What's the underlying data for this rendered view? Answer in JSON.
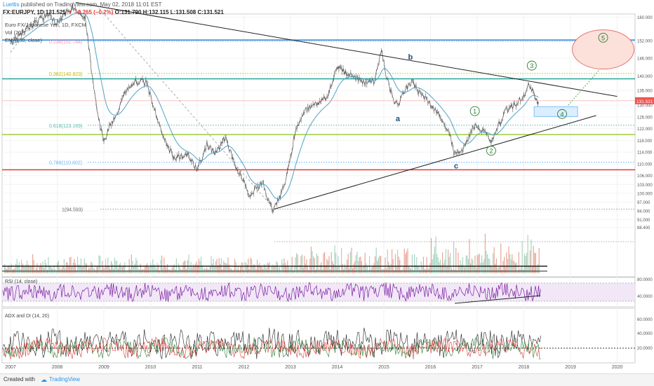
{
  "header": {
    "author": "Luettis",
    "published": " published on TradingView.com, May 02, 2018 11:01 EST",
    "symbol": "FX:EURJPY, 1D",
    "last": "131.525",
    "change": "▼ −0.265 (−0.2%)",
    "ohlc": "O:131.790 H:132.115 L:131.508 C:131.521"
  },
  "legend": {
    "series": "Euro FX/Japanese Yen, 1D, FXCM",
    "volume": "Vol (20)",
    "ema": "EMA (50, close)"
  },
  "footer": {
    "created": "Created with",
    "brand": "TradingView"
  },
  "colors": {
    "price": "#5a5a5a",
    "ema": "#4fa3c7",
    "rsi": "#7b1fa2",
    "adx": "#222222",
    "di_plus": "#2e7d32",
    "di_minus": "#e53935",
    "volume_up": "#e8a79a",
    "volume_down": "#a8d5c2",
    "trendline": "#222222",
    "wave_label": "#2e7d32",
    "letter_label": "#1f4e79"
  },
  "chart_data": [
    {
      "type": "line",
      "title": "",
      "x_axis": [
        "2007",
        "2008",
        "2009",
        "2010",
        "2011",
        "2012",
        "2013",
        "2014",
        "2015",
        "2016",
        "2017",
        "2018",
        "2019",
        "2020"
      ],
      "y_axis_ticks": [
        "160.000",
        "152.000",
        "146.000",
        "140.000",
        "135.000",
        "130.000",
        "126.000",
        "122.000",
        "118.000",
        "114.000",
        "110.000",
        "106.000",
        "103.000",
        "100.000",
        "97.000",
        "94.000",
        "91.000",
        "88.400"
      ],
      "last_price_label": "131.521",
      "price_path": [
        [
          "2007.0",
          151
        ],
        [
          "2007.2",
          154
        ],
        [
          "2007.5",
          158
        ],
        [
          "2007.8",
          161
        ],
        [
          "2008.0",
          158
        ],
        [
          "2008.3",
          163
        ],
        [
          "2008.6",
          160
        ],
        [
          "2008.75",
          140
        ],
        [
          "2008.85",
          128
        ],
        [
          "2009.0",
          117
        ],
        [
          "2009.1",
          122
        ],
        [
          "2009.3",
          128
        ],
        [
          "2009.5",
          136
        ],
        [
          "2009.7",
          138
        ],
        [
          "2009.9",
          138
        ],
        [
          "2010.1",
          128
        ],
        [
          "2010.3",
          118
        ],
        [
          "2010.5",
          112
        ],
        [
          "2010.8",
          113
        ],
        [
          "2011.0",
          108
        ],
        [
          "2011.2",
          116
        ],
        [
          "2011.4",
          114
        ],
        [
          "2011.6",
          119
        ],
        [
          "2011.8",
          110
        ],
        [
          "2012.0",
          104
        ],
        [
          "2012.1",
          99
        ],
        [
          "2012.3",
          102
        ],
        [
          "2012.4",
          104
        ],
        [
          "2012.55",
          96
        ],
        [
          "2012.65",
          94.6
        ],
        [
          "2012.8",
          100
        ],
        [
          "2012.9",
          104
        ],
        [
          "2013.0",
          112
        ],
        [
          "2013.1",
          121
        ],
        [
          "2013.3",
          128
        ],
        [
          "2013.5",
          130
        ],
        [
          "2013.8",
          133
        ],
        [
          "2014.0",
          143
        ],
        [
          "2014.2",
          141
        ],
        [
          "2014.4",
          139
        ],
        [
          "2014.6",
          138
        ],
        [
          "2014.8",
          138
        ],
        [
          "2014.95",
          149
        ],
        [
          "2015.05",
          140
        ],
        [
          "2015.2",
          132
        ],
        [
          "2015.3",
          130
        ],
        [
          "2015.45",
          135
        ],
        [
          "2015.6",
          138
        ],
        [
          "2015.8",
          134
        ],
        [
          "2016.0",
          130
        ],
        [
          "2016.2",
          126
        ],
        [
          "2016.4",
          121
        ],
        [
          "2016.5",
          114
        ],
        [
          "2016.6",
          113
        ],
        [
          "2016.75",
          116
        ],
        [
          "2016.9",
          122
        ],
        [
          "2017.0",
          123
        ],
        [
          "2017.15",
          121
        ],
        [
          "2017.3",
          118
        ],
        [
          "2017.45",
          123
        ],
        [
          "2017.6",
          128
        ],
        [
          "2017.8",
          130
        ],
        [
          "2018.0",
          133
        ],
        [
          "2018.1",
          137
        ],
        [
          "2018.2",
          134
        ],
        [
          "2018.3",
          131
        ],
        [
          "2018.33",
          131.5
        ]
      ],
      "fib_levels": [
        {
          "label": "0.236(151.744)",
          "value": 151.744,
          "color": "#f48fb1"
        },
        {
          "label": "0.382(140.823)",
          "value": 140.823,
          "color": "#c6b400"
        },
        {
          "label": "0.618(123.169)",
          "value": 123.169,
          "color": "#4db6ac"
        },
        {
          "label": "0.786(110.602)",
          "value": 110.602,
          "color": "#64b5f6"
        },
        {
          "label": "1(94.593)",
          "value": 94.593,
          "color": "#9e9e9e"
        }
      ],
      "horizontal_lines": [
        {
          "value": 152.2,
          "color": "#1e88e5"
        },
        {
          "value": 139,
          "color": "#26a69a"
        },
        {
          "value": 120,
          "color": "#9ccc3c"
        },
        {
          "value": 108,
          "color": "#e53935"
        }
      ],
      "wave_labels": [
        {
          "text": "1",
          "x": "2016.95",
          "y": 128,
          "circled": true
        },
        {
          "text": "2",
          "x": "2017.3",
          "y": 114.5,
          "circled": true
        },
        {
          "text": "3",
          "x": "2018.17",
          "y": 143.5,
          "circled": true
        },
        {
          "text": "4",
          "x": "2018.82",
          "y": 127,
          "circled": true
        },
        {
          "text": "5",
          "x": "2019.7",
          "y": 153,
          "circled": true
        },
        {
          "text": "a",
          "x": "2015.3",
          "y": 124.5,
          "circled": false
        },
        {
          "text": "b",
          "x": "2015.57",
          "y": 145.5,
          "circled": false
        },
        {
          "text": "c",
          "x": "2016.55",
          "y": 108.5,
          "circled": false
        }
      ]
    },
    {
      "type": "line",
      "title": "RSI (14, close)",
      "y_axis_ticks": [
        "80.0000",
        "40.0000"
      ],
      "band": [
        30,
        70
      ]
    },
    {
      "type": "line",
      "title": "ADX and DI (14, 20)",
      "y_axis_ticks": [
        "60.0000",
        "40.0000",
        "20.0000"
      ],
      "series": [
        {
          "name": "ADX"
        },
        {
          "name": "+DI"
        },
        {
          "name": "−DI"
        }
      ]
    }
  ]
}
